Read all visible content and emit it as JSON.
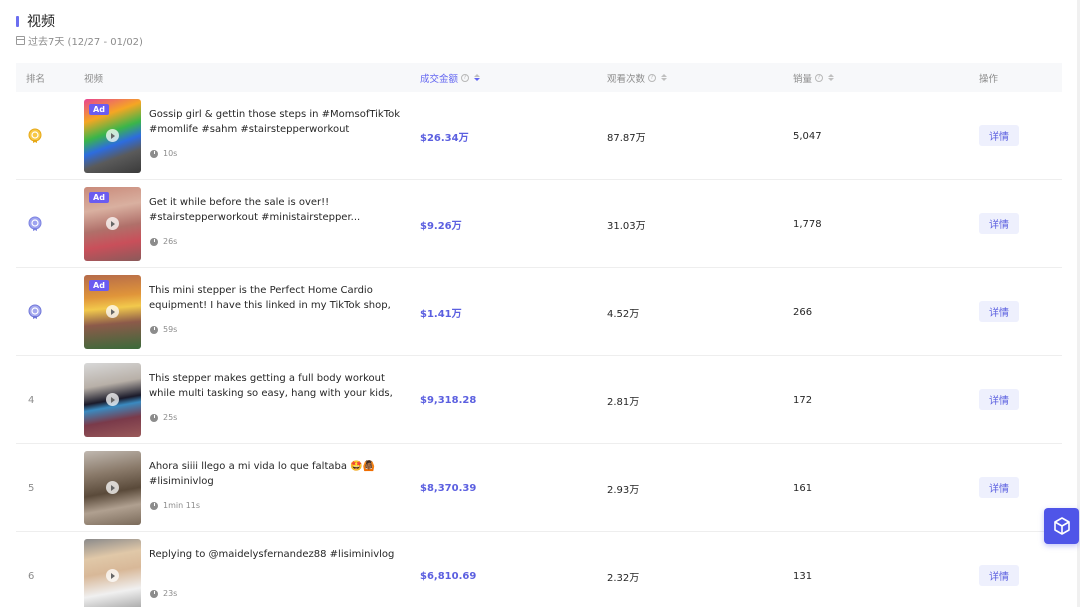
{
  "section": {
    "title": "视频",
    "date_range": "过去7天 (12/27 - 01/02)"
  },
  "table": {
    "headers": {
      "rank": "排名",
      "video": "视频",
      "gmv": "成交金额",
      "views": "观看次数",
      "sales": "销量",
      "action": "操作"
    },
    "sorted_column": "成交金额",
    "rows": [
      {
        "rank": "1",
        "ad": "Ad",
        "description": "Gossip girl & gettin those steps in #MomsofTikTok #momlife #sahm #stairstepperworkout #TikTokShop...",
        "duration": "10s",
        "gmv": "$26.34万",
        "views": "87.87万",
        "sales": "5,047",
        "action": "详情"
      },
      {
        "rank": "2",
        "ad": "Ad",
        "description": "Get it while before the sale is over!! #stairstepperworkout #ministairstepper...",
        "duration": "26s",
        "gmv": "$9.26万",
        "views": "31.03万",
        "sales": "1,778",
        "action": "详情"
      },
      {
        "rank": "3",
        "ad": "Ad",
        "description": "This mini stepper is the Perfect Home Cardio equipment! I have this linked in my TikTok shop, as we...",
        "duration": "59s",
        "gmv": "$1.41万",
        "views": "4.52万",
        "sales": "266",
        "action": "详情"
      },
      {
        "rank": "4",
        "ad": "",
        "description": "This stepper makes getting a full body workout while multi tasking so easy, hang with your kids, read a boo...",
        "duration": "25s",
        "gmv": "$9,318.28",
        "views": "2.81万",
        "sales": "172",
        "action": "详情"
      },
      {
        "rank": "5",
        "ad": "",
        "description": "Ahora siiii llego a mi vida lo que faltaba 🤩🙆🏾 #lisiminivlog",
        "duration": "1min 11s",
        "gmv": "$8,370.39",
        "views": "2.93万",
        "sales": "161",
        "action": "详情"
      },
      {
        "rank": "6",
        "ad": "",
        "description": "Replying to @maidelysfernandez88 #lisiminivlog",
        "duration": "23s",
        "gmv": "$6,810.69",
        "views": "2.32万",
        "sales": "131",
        "action": "详情"
      }
    ]
  },
  "colors": {
    "accent": "#5b5fe0",
    "gold": "#f0b429",
    "silver": "#8a8fe8",
    "bronze": "#7b82e0"
  }
}
